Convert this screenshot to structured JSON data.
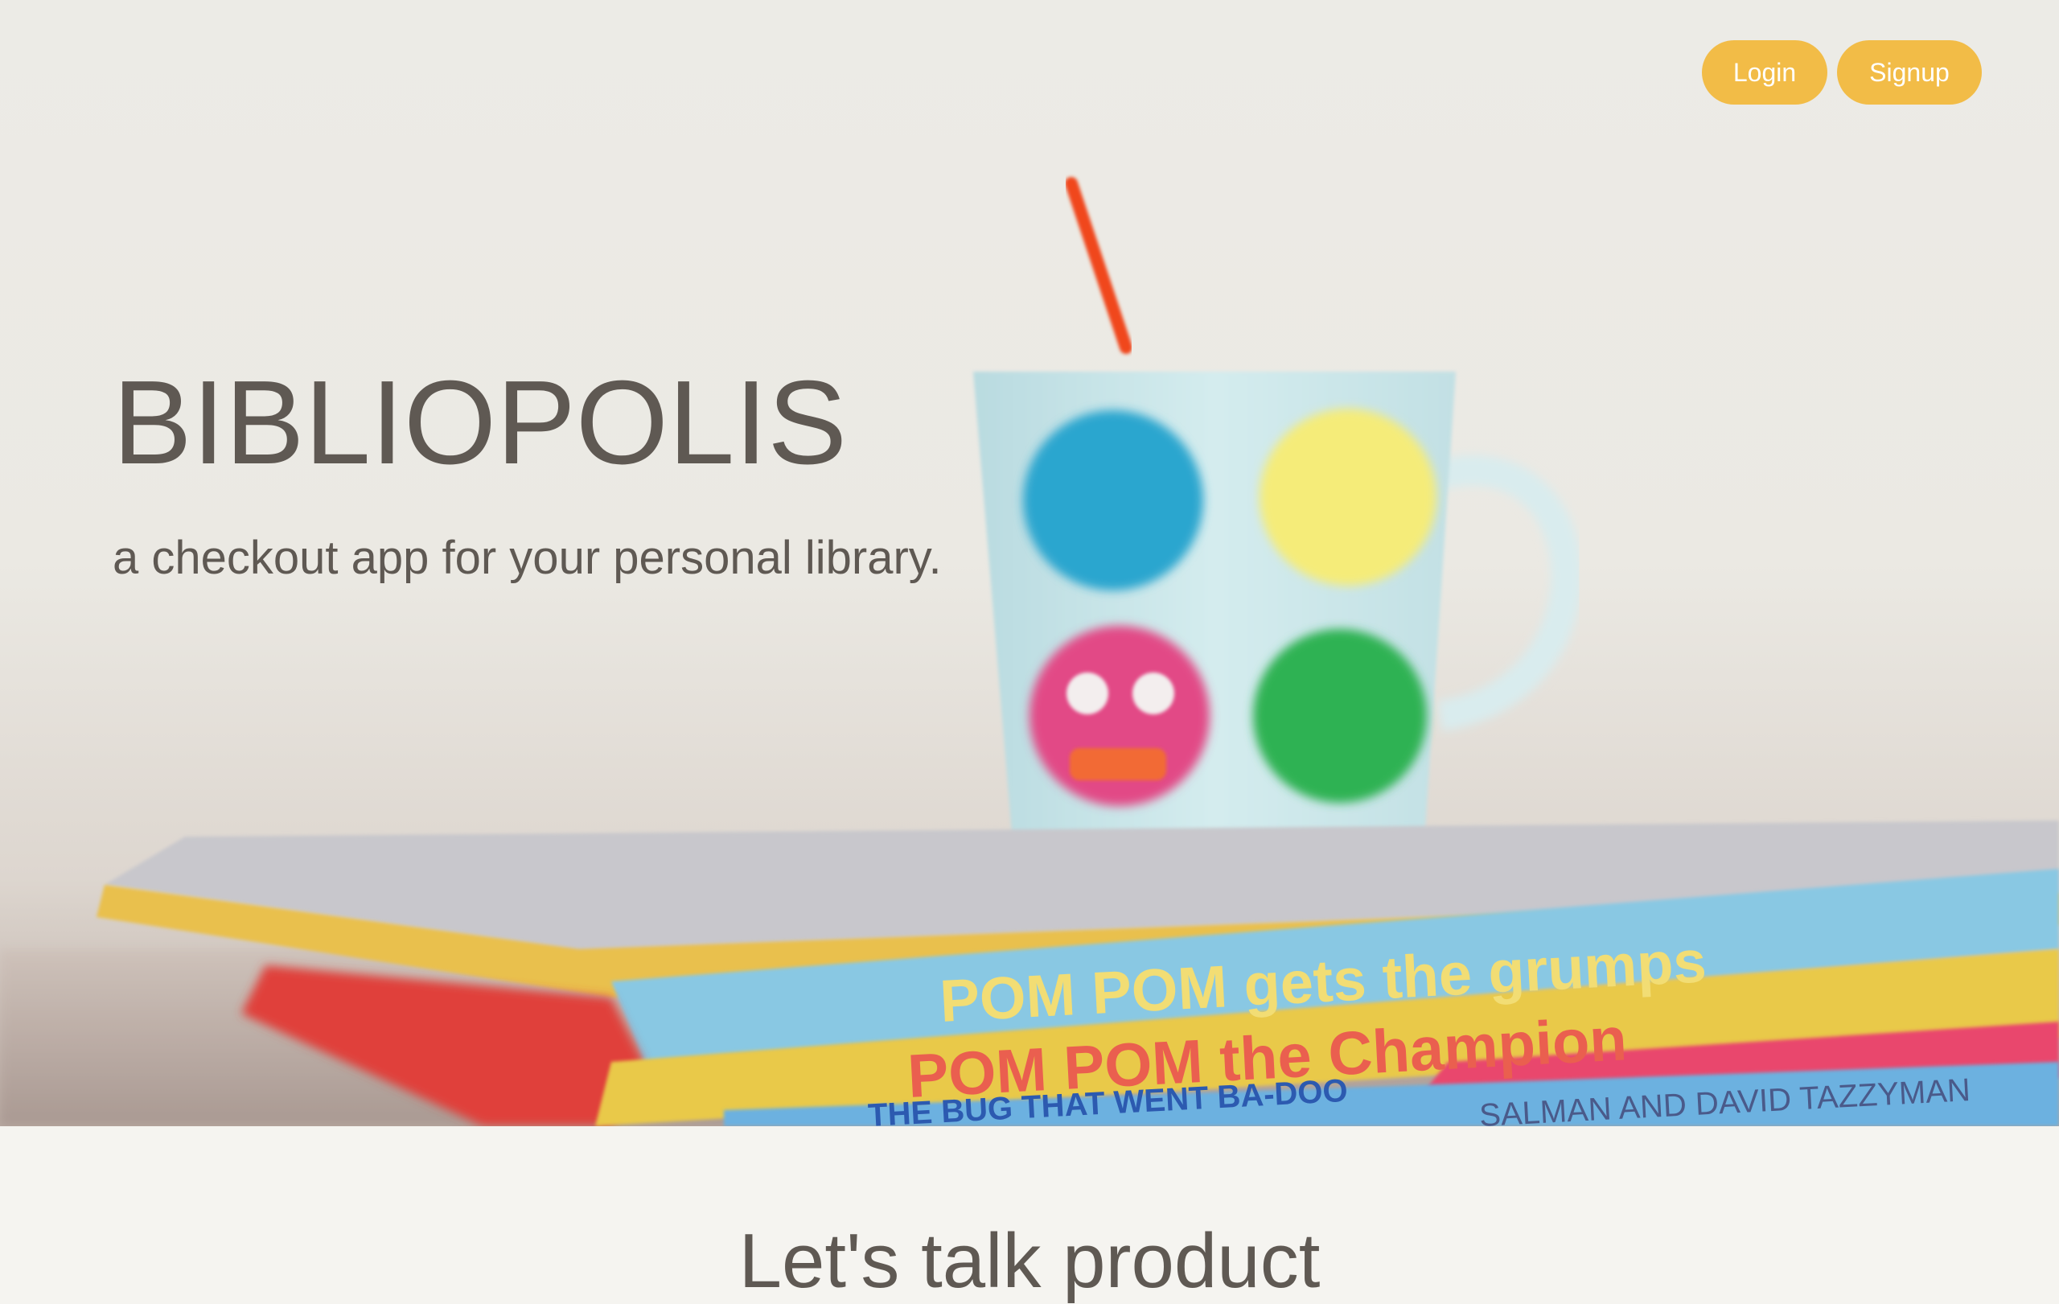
{
  "nav": {
    "login_label": "Login",
    "signup_label": "Signup"
  },
  "hero": {
    "title": "BIBLIOPOLIS",
    "tagline": "a checkout app for your personal library.",
    "book_spines": [
      "POM POM gets the grumps",
      "POM POM the Champion",
      "THE BUG THAT WENT BA-DOO",
      "SALMAN AND DAVID TAZZYMAN"
    ]
  },
  "section": {
    "title": "Let's talk product"
  },
  "colors": {
    "accent": "#f2bc47",
    "text": "#5f5953",
    "page_background": "#f5f4f0"
  }
}
